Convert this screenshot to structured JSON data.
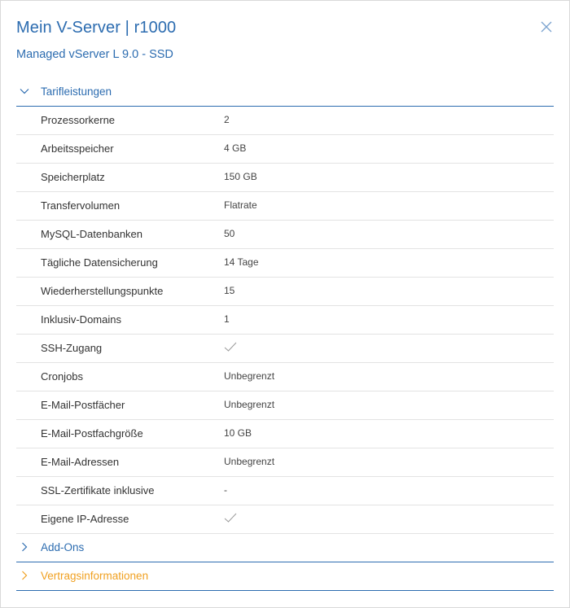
{
  "header": {
    "title": "Mein V-Server | r1000",
    "subtitle": "Managed vServer L 9.0 - SSD"
  },
  "sections": {
    "tarif": {
      "label": "Tarifleistungen",
      "expanded": true,
      "color": "#2c6cb0"
    },
    "addons": {
      "label": "Add-Ons",
      "expanded": false,
      "color": "#2c6cb0"
    },
    "vertrag": {
      "label": "Vertragsinformationen",
      "expanded": false,
      "color": "#f0a020"
    }
  },
  "features": [
    {
      "label": "Prozessorkerne",
      "value": "2"
    },
    {
      "label": "Arbeitsspeicher",
      "value": "4 GB"
    },
    {
      "label": "Speicherplatz",
      "value": "150 GB"
    },
    {
      "label": "Transfervolumen",
      "value": "Flatrate"
    },
    {
      "label": "MySQL-Datenbanken",
      "value": "50"
    },
    {
      "label": "Tägliche Datensicherung",
      "value": "14 Tage"
    },
    {
      "label": "Wiederherstellungspunkte",
      "value": "15"
    },
    {
      "label": "Inklusiv-Domains",
      "value": "1"
    },
    {
      "label": "SSH-Zugang",
      "value": null,
      "icon": "checkmark-icon"
    },
    {
      "label": "Cronjobs",
      "value": "Unbegrenzt"
    },
    {
      "label": "E-Mail-Postfächer",
      "value": "Unbegrenzt"
    },
    {
      "label": "E-Mail-Postfachgröße",
      "value": "10 GB"
    },
    {
      "label": "E-Mail-Adressen",
      "value": "Unbegrenzt"
    },
    {
      "label": "SSL-Zertifikate inklusive",
      "value": "-"
    },
    {
      "label": "Eigene IP-Adresse",
      "value": null,
      "icon": "checkmark-icon"
    }
  ],
  "icons": {
    "close": "close-icon",
    "collapse": "chevron-down-icon",
    "expand": "chevron-right-icon"
  },
  "colors": {
    "accent": "#2c6cb0",
    "secondary_accent": "#f0a020",
    "divider": "#e3e3e3"
  }
}
